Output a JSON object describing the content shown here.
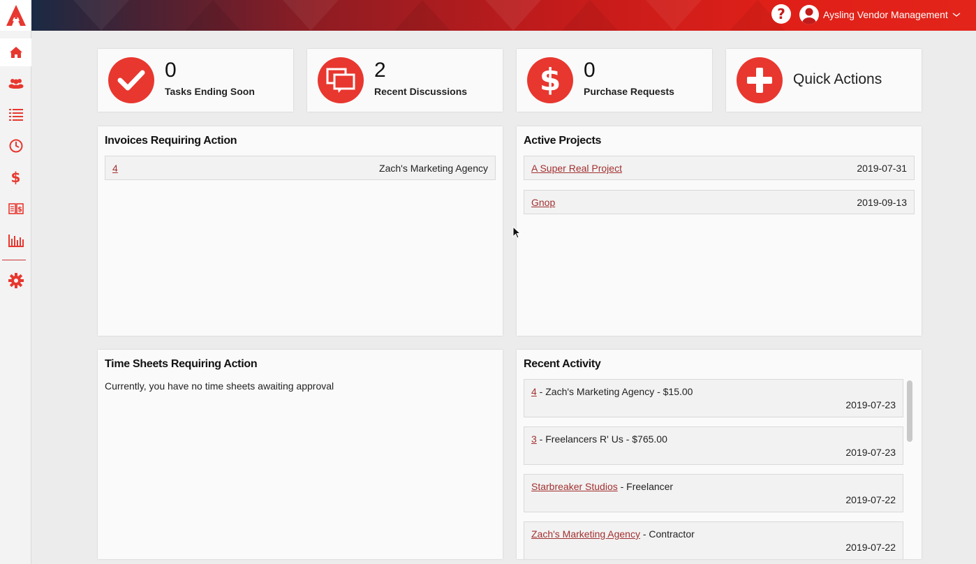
{
  "header": {
    "help_icon": "question-mark-icon",
    "user_icon": "user-avatar-icon",
    "account_name": "Aysling Vendor Management",
    "dropdown_icon": "chevron-down-icon"
  },
  "sidebar": {
    "items": [
      {
        "icon": "home-icon",
        "active": true
      },
      {
        "icon": "users-icon"
      },
      {
        "icon": "list-icon"
      },
      {
        "icon": "clock-icon"
      },
      {
        "icon": "dollar-icon"
      },
      {
        "icon": "invoice-icon"
      },
      {
        "icon": "bar-chart-icon"
      },
      {
        "icon": "gear-icon"
      }
    ]
  },
  "stats": [
    {
      "count": "0",
      "label": "Tasks Ending Soon",
      "icon": "checkmark-icon"
    },
    {
      "count": "2",
      "label": "Recent Discussions",
      "icon": "chat-bubbles-icon"
    },
    {
      "count": "0",
      "label": "Purchase Requests",
      "icon": "dollar-sign-icon"
    },
    {
      "label": "Quick Actions",
      "icon": "plus-icon"
    }
  ],
  "invoices": {
    "title": "Invoices Requiring Action",
    "rows": [
      {
        "id": "4",
        "vendor": "Zach's Marketing Agency"
      }
    ]
  },
  "projects": {
    "title": "Active Projects",
    "rows": [
      {
        "name": "A Super Real Project",
        "date": "2019-07-31"
      },
      {
        "name": "Gnop",
        "date": "2019-09-13"
      }
    ]
  },
  "timesheets": {
    "title": "Time Sheets Requiring Action",
    "empty_message": "Currently, you have no time sheets awaiting approval"
  },
  "activity": {
    "title": "Recent Activity",
    "items": [
      {
        "link": "4",
        "text": " - Zach's Marketing Agency - $15.00",
        "date": "2019-07-23"
      },
      {
        "link": "3",
        "text": " - Freelancers R' Us - $765.00",
        "date": "2019-07-23"
      },
      {
        "link": "Starbreaker Studios",
        "text": " - Freelancer",
        "date": "2019-07-22"
      },
      {
        "link": "Zach's Marketing Agency",
        "text": " - Contractor",
        "date": "2019-07-22"
      }
    ]
  },
  "colors": {
    "accent": "#e8372f",
    "link": "#a23030",
    "header_dark": "#1a2a44",
    "header_red": "#e3241b"
  }
}
